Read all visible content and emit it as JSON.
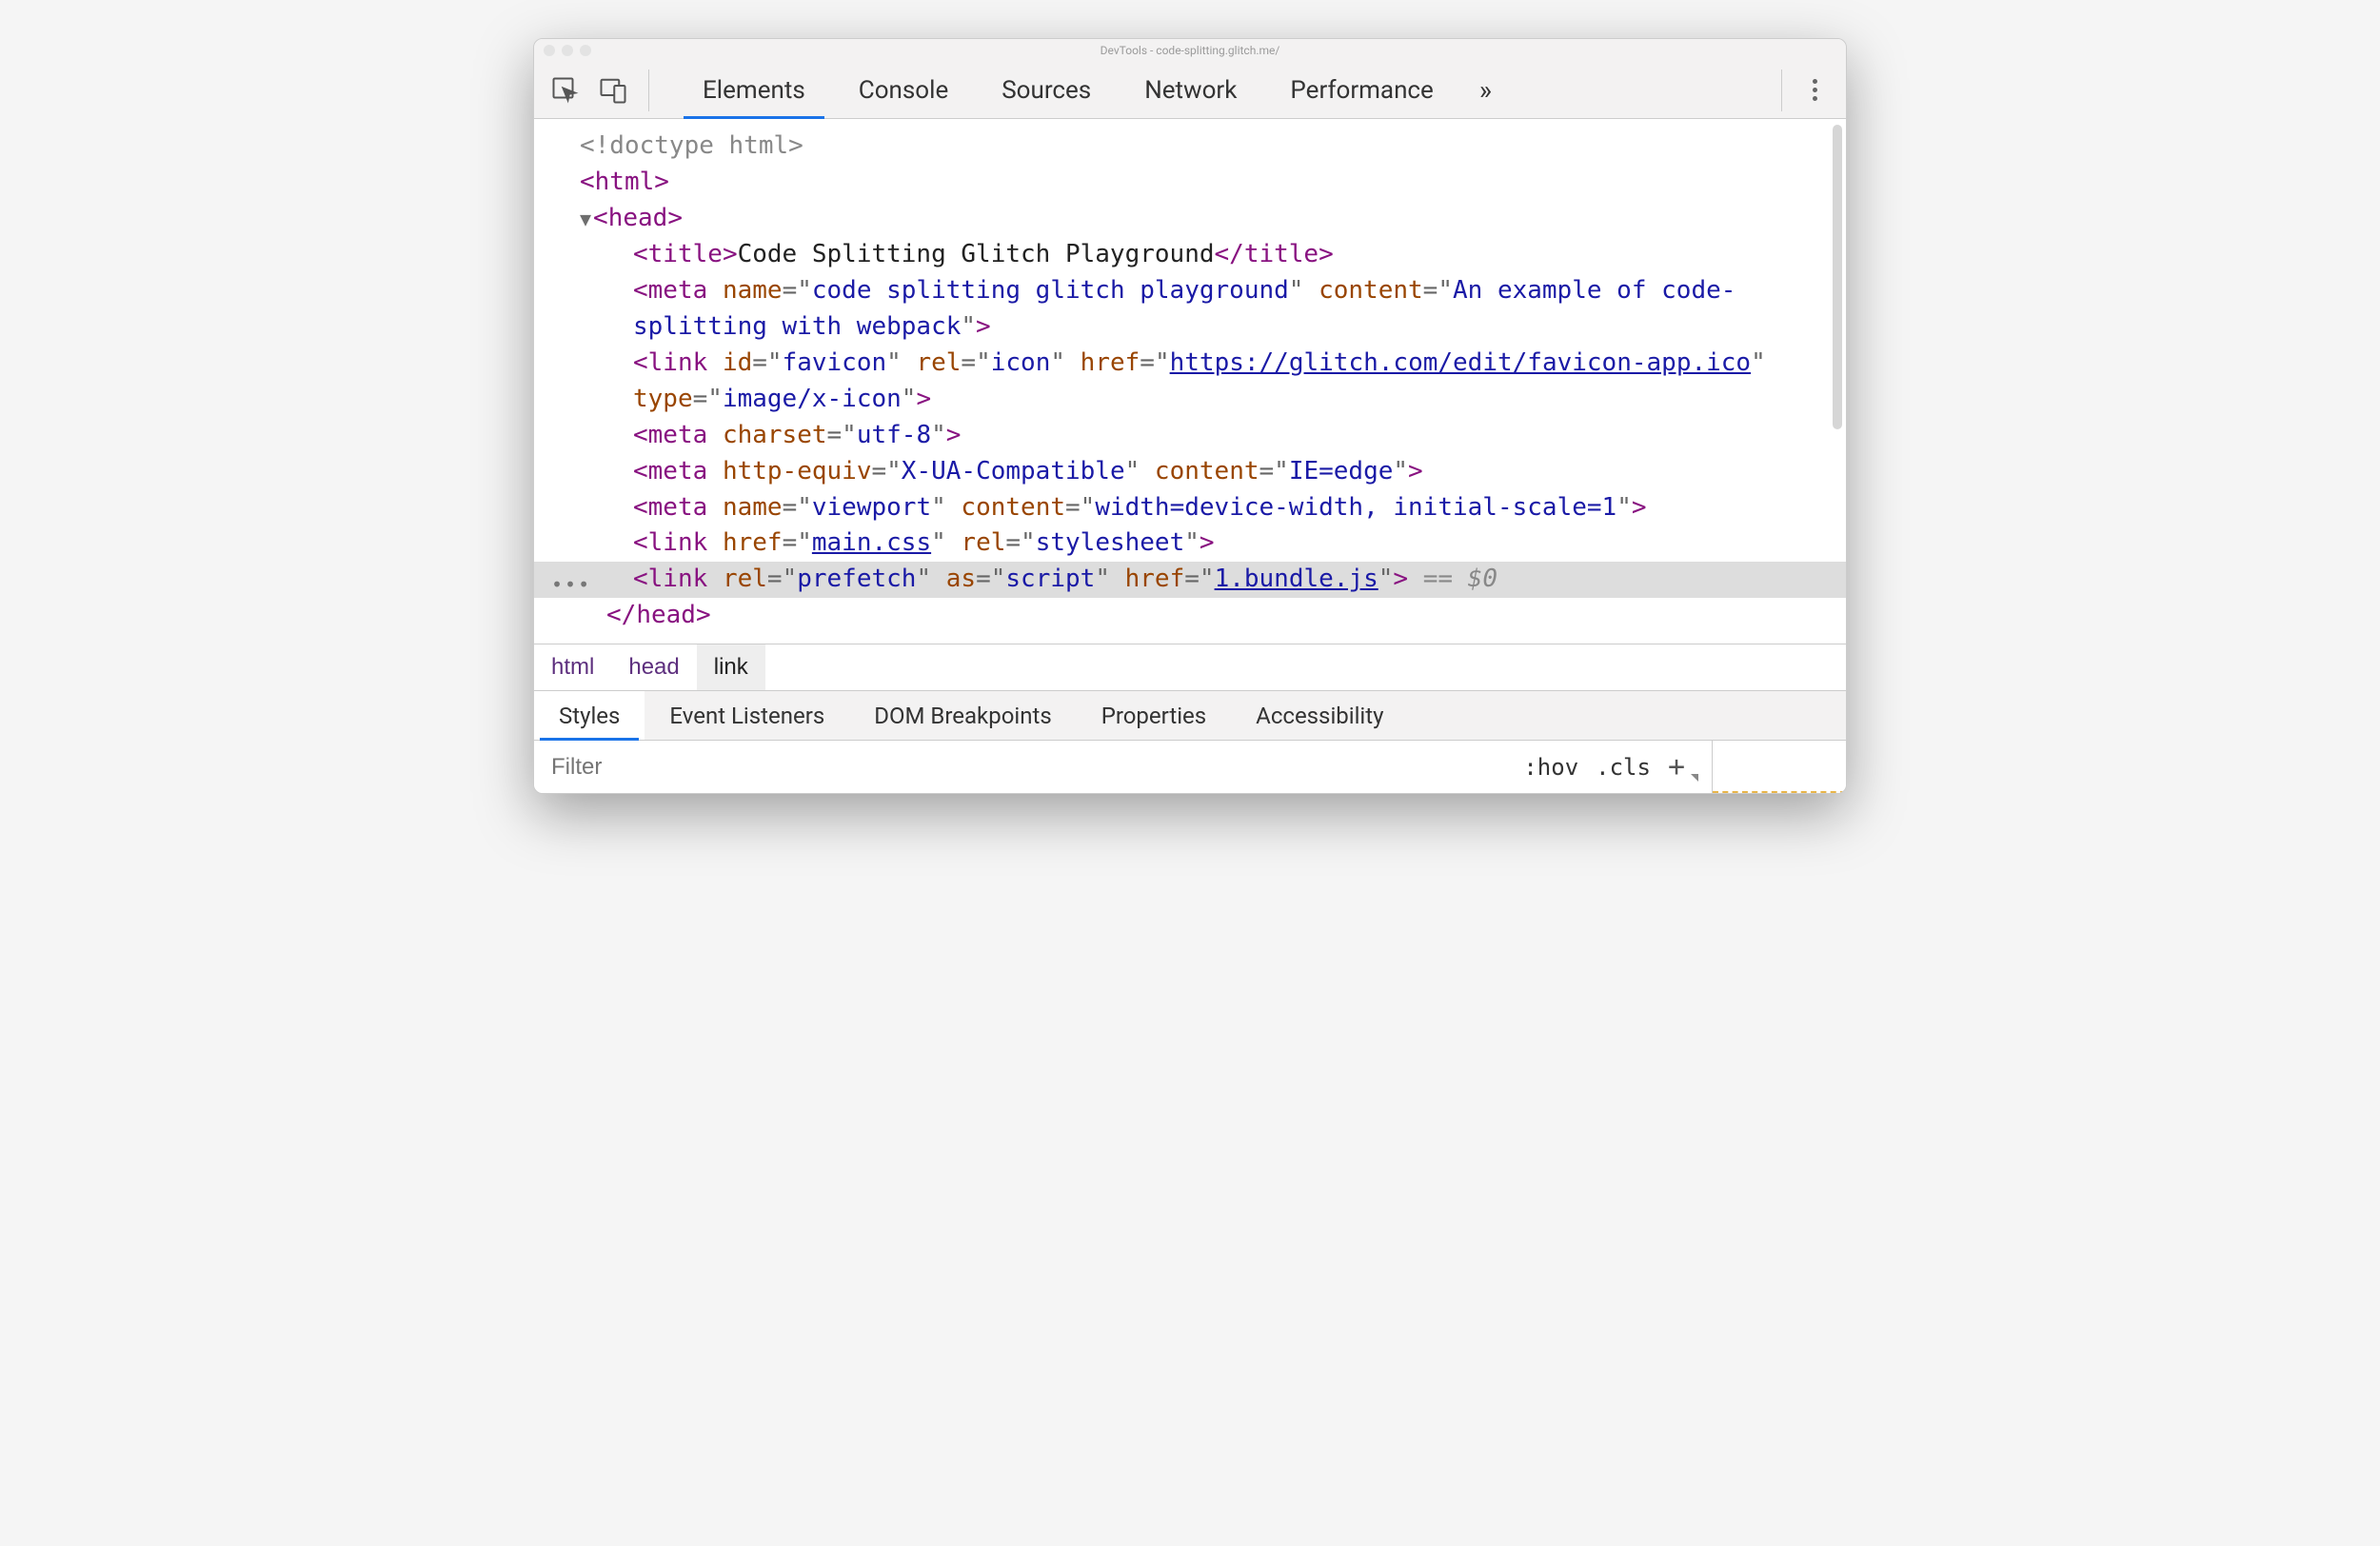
{
  "window": {
    "title": "DevTools - code-splitting.glitch.me/"
  },
  "toolbar": {
    "tabs": [
      "Elements",
      "Console",
      "Sources",
      "Network",
      "Performance"
    ],
    "active_tab_index": 0,
    "more_glyph": "»"
  },
  "dom": {
    "doctype": "<!doctype html>",
    "html_open": "html",
    "head_open": "head",
    "title_tag": "title",
    "title_text": "Code Splitting Glitch Playground",
    "meta1": {
      "tag": "meta",
      "attrs": [
        {
          "n": "name",
          "v": "code splitting glitch playground"
        },
        {
          "n": "content",
          "v": "An example of code-splitting with webpack"
        }
      ]
    },
    "link1": {
      "tag": "link",
      "attrs": [
        {
          "n": "id",
          "v": "favicon"
        },
        {
          "n": "rel",
          "v": "icon"
        },
        {
          "n": "href",
          "v": "https://glitch.com/edit/favicon-app.ico",
          "link": true
        },
        {
          "n": "type",
          "v": "image/x-icon"
        }
      ]
    },
    "meta2": {
      "tag": "meta",
      "attrs": [
        {
          "n": "charset",
          "v": "utf-8"
        }
      ]
    },
    "meta3": {
      "tag": "meta",
      "attrs": [
        {
          "n": "http-equiv",
          "v": "X-UA-Compatible"
        },
        {
          "n": "content",
          "v": "IE=edge"
        }
      ]
    },
    "meta4": {
      "tag": "meta",
      "attrs": [
        {
          "n": "name",
          "v": "viewport"
        },
        {
          "n": "content",
          "v": "width=device-width, initial-scale=1"
        }
      ]
    },
    "link2": {
      "tag": "link",
      "attrs": [
        {
          "n": "href",
          "v": "main.css",
          "link": true
        },
        {
          "n": "rel",
          "v": "stylesheet"
        }
      ]
    },
    "link3": {
      "tag": "link",
      "attrs": [
        {
          "n": "rel",
          "v": "prefetch"
        },
        {
          "n": "as",
          "v": "script"
        },
        {
          "n": "href",
          "v": "1.bundle.js",
          "link": true
        }
      ]
    },
    "selected_suffix": " == $0",
    "head_close": "head"
  },
  "breadcrumb": [
    "html",
    "head",
    "link"
  ],
  "styles_tabs": [
    "Styles",
    "Event Listeners",
    "DOM Breakpoints",
    "Properties",
    "Accessibility"
  ],
  "styles_active_index": 0,
  "filter": {
    "placeholder": "Filter",
    "hov": ":hov",
    "cls": ".cls"
  }
}
